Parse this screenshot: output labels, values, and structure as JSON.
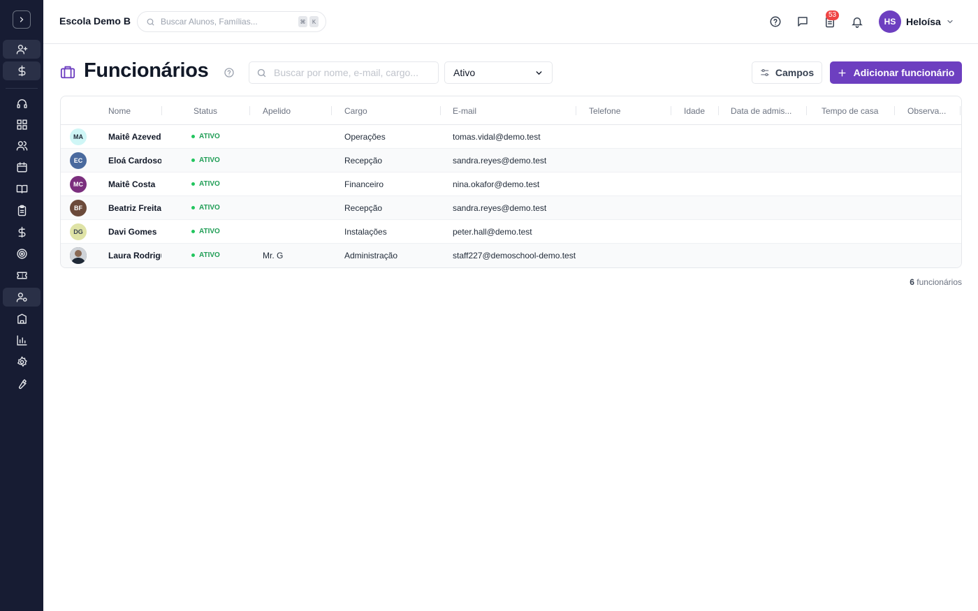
{
  "header": {
    "school_name": "Escola Demo B",
    "search_placeholder": "Buscar Alunos, Famílias...",
    "kbd_1": "⌘",
    "kbd_2": "K",
    "tasks_badge": "53",
    "user_initials": "HS",
    "user_name": "Heloísa"
  },
  "page": {
    "title": "Funcionários",
    "search_placeholder": "Buscar por nome, e-mail, cargo...",
    "status_filter": "Ativo",
    "fields_button": "Campos",
    "add_button": "Adicionar funcionário"
  },
  "table": {
    "columns": [
      "Nome",
      "Status",
      "Apelido",
      "Cargo",
      "E-mail",
      "Telefone",
      "Idade",
      "Data de admis...",
      "Tempo de casa",
      "Observa..."
    ],
    "rows": [
      {
        "initials": "MA",
        "name": "Maitê Azevedo",
        "status": "ATIVO",
        "nickname": "",
        "role": "Operações",
        "email": "tomas.vidal@demo.test",
        "avatar_bg": "#cff6f6",
        "avatar_fg": "#1f2937"
      },
      {
        "initials": "EC",
        "name": "Eloá Cardoso",
        "status": "ATIVO",
        "nickname": "",
        "role": "Recepção",
        "email": "sandra.reyes@demo.test",
        "avatar_bg": "#4a6a9e",
        "avatar_fg": "#ffffff"
      },
      {
        "initials": "MC",
        "name": "Maitê Costa",
        "status": "ATIVO",
        "nickname": "",
        "role": "Financeiro",
        "email": "nina.okafor@demo.test",
        "avatar_bg": "#7b2f7e",
        "avatar_fg": "#ffffff"
      },
      {
        "initials": "BF",
        "name": "Beatriz Freitas",
        "status": "ATIVO",
        "nickname": "",
        "role": "Recepção",
        "email": "sandra.reyes@demo.test",
        "avatar_bg": "#6b4a3a",
        "avatar_fg": "#ffffff"
      },
      {
        "initials": "DG",
        "name": "Davi Gomes",
        "status": "ATIVO",
        "nickname": "",
        "role": "Instalações",
        "email": "peter.hall@demo.test",
        "avatar_bg": "#dfe3a6",
        "avatar_fg": "#374151"
      },
      {
        "initials": "",
        "name": "Laura Rodrigues",
        "status": "ATIVO",
        "nickname": "Mr. G",
        "role": "Administração",
        "email": "staff227@demoschool-demo.test",
        "avatar_bg": "#3a3f4a",
        "avatar_fg": "#ffffff"
      }
    ]
  },
  "footer": {
    "count": "6",
    "count_label": "funcionários"
  },
  "colors": {
    "accent": "#6d3fc0",
    "sidebar": "#171c33",
    "status_green": "#1f9d55"
  },
  "icons": {
    "sidebar": [
      "chevron-right-icon",
      "user-plus-icon",
      "dollar-icon",
      "headset-icon",
      "dashboard-icon",
      "users-icon",
      "calendar-icon",
      "book-icon",
      "clipboard-icon",
      "dollar-icon",
      "target-icon",
      "ticket-icon",
      "user-cog-icon",
      "building-icon",
      "bar-chart-icon",
      "settings-icon",
      "wrench-icon"
    ]
  }
}
